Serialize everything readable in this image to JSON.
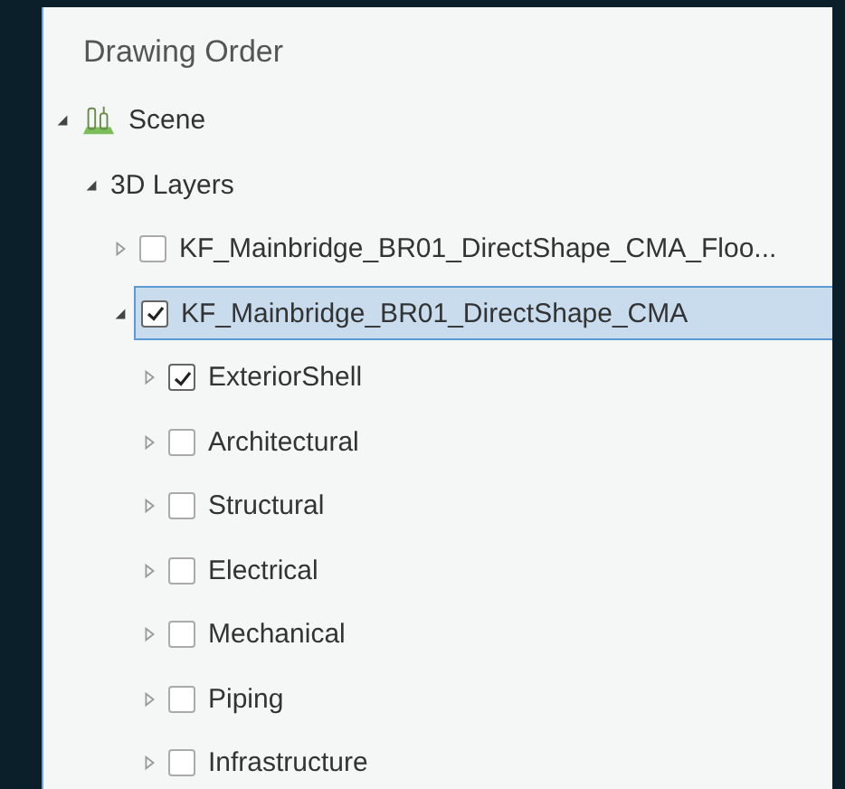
{
  "panel": {
    "title": "Drawing Order"
  },
  "tree": [
    {
      "kind": "scene",
      "label": "Scene",
      "expanded": true,
      "selected": false,
      "children": [
        {
          "kind": "group",
          "label": "3D Layers",
          "expanded": true,
          "selected": false,
          "children": [
            {
              "kind": "layer",
              "label": "KF_Mainbridge_BR01_DirectShape_CMA_Floo...",
              "expanded": false,
              "checked": false,
              "selected": false
            },
            {
              "kind": "layer",
              "label": "KF_Mainbridge_BR01_DirectShape_CMA",
              "expanded": true,
              "checked": true,
              "selected": true,
              "children": [
                {
                  "kind": "layer",
                  "label": "ExteriorShell",
                  "expanded": false,
                  "checked": true,
                  "selected": false
                },
                {
                  "kind": "layer",
                  "label": "Architectural",
                  "expanded": false,
                  "checked": false,
                  "selected": false
                },
                {
                  "kind": "layer",
                  "label": "Structural",
                  "expanded": false,
                  "checked": false,
                  "selected": false
                },
                {
                  "kind": "layer",
                  "label": "Electrical",
                  "expanded": false,
                  "checked": false,
                  "selected": false
                },
                {
                  "kind": "layer",
                  "label": "Mechanical",
                  "expanded": false,
                  "checked": false,
                  "selected": false
                },
                {
                  "kind": "layer",
                  "label": "Piping",
                  "expanded": false,
                  "checked": false,
                  "selected": false
                },
                {
                  "kind": "layer",
                  "label": "Infrastructure",
                  "expanded": false,
                  "checked": false,
                  "selected": false
                }
              ]
            }
          ]
        }
      ]
    }
  ]
}
